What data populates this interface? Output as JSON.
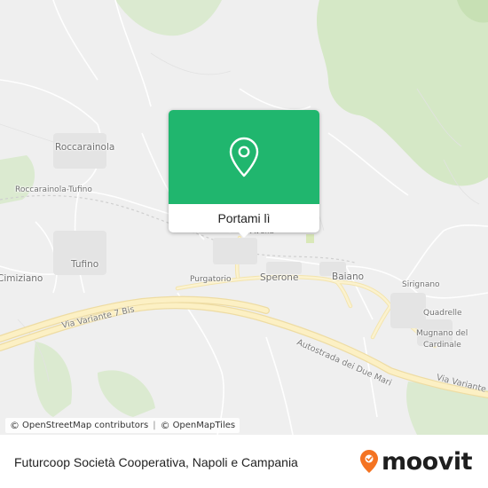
{
  "map": {
    "places": {
      "roccarainola": "Roccarainola",
      "roccarainola_tufino": "Roccarainola-Tufino",
      "tufino": "Tufino",
      "cimitile": "Cimiziano",
      "avella": "Avella",
      "purgatorio": "Purgatorio",
      "sperone": "Sperone",
      "baiano": "Baiano",
      "sirignano": "Sirignano",
      "quadrelle": "Quadrelle",
      "mugnano": "Mugnano del",
      "mugnano_2": "Cardinale"
    },
    "roads": {
      "via_variante_7bis": "Via Variante 7 Bis",
      "autostrada": "Autostrada dei Due Mari",
      "via_variante_right": "Via Variante"
    },
    "colors": {
      "land": "#efefef",
      "green": "#cfe5c0",
      "road_major": "#fbeec0",
      "road_major_edge": "#ecd9a0",
      "water": "#c6d9e6",
      "brand_green": "#20b66e",
      "moovit_orange": "#f47321"
    }
  },
  "attribution": {
    "copy1": "©",
    "osm_contrib": "OpenStreetMap contributors",
    "copy2": "©",
    "omt": "OpenMapTiles"
  },
  "popup": {
    "pin_icon": "location-pin-icon",
    "button_label": "Portami lì"
  },
  "footer": {
    "title": "Futurcoop Società Cooperativa, Napoli e Campania",
    "brand": "moovit"
  }
}
